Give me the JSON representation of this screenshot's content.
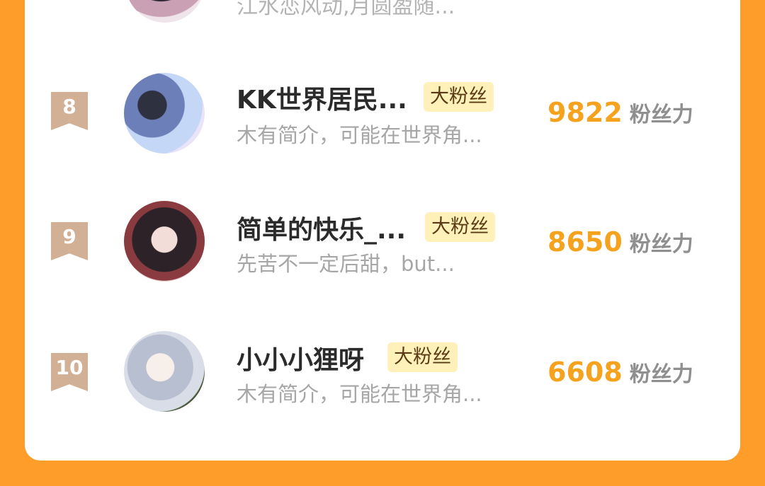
{
  "top_partial": {
    "description": "江水恋风动,月圆盈随..."
  },
  "rows": [
    {
      "rank": "8",
      "name": "KK世界居民...",
      "badge": "大粉丝",
      "description": "木有简介，可能在世界角...",
      "score": "9822",
      "unit": "粉丝力"
    },
    {
      "rank": "9",
      "name": "简单的快乐_...",
      "badge": "大粉丝",
      "description": "先苦不一定后甜，but...",
      "score": "8650",
      "unit": "粉丝力"
    },
    {
      "rank": "10",
      "name": "小小小狸呀",
      "badge": "大粉丝",
      "description": "木有简介，可能在世界角...",
      "score": "6608",
      "unit": "粉丝力"
    }
  ]
}
